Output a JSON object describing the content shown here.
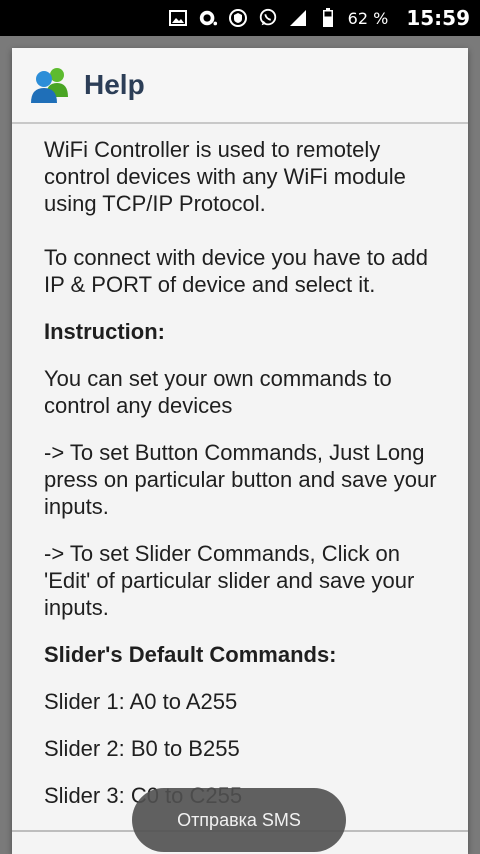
{
  "status_bar": {
    "battery_percent": "62 %",
    "time": "15:59",
    "icons": [
      "gallery-icon",
      "sync-icon",
      "shield-icon",
      "whatsapp-icon",
      "signal-icon",
      "battery-icon"
    ]
  },
  "dialog": {
    "title": "Help",
    "logo_icon": "users-icon",
    "paragraphs": [
      "WiFi Controller is used to remotely control devices with any WiFi module using TCP/IP Protocol.",
      "To connect with device you have to add IP & PORT of device and select it.",
      "Instruction:",
      "You can set your own commands to control any devices",
      "-> To set Button Commands, Just Long press on particular button and save your inputs.",
      "-> To set Slider Commands, Click on 'Edit' of particular slider and save your inputs.",
      "Slider's Default Commands:",
      "Slider 1: A0 to A255",
      "Slider 2: B0 to B255",
      "Slider 3: C0 to C255"
    ]
  },
  "toast": {
    "text": "Отправка SMS"
  },
  "colors": {
    "title": "#2c3e57",
    "dialog_bg": "#f4f4f4",
    "backdrop": "#7a7a7a"
  }
}
